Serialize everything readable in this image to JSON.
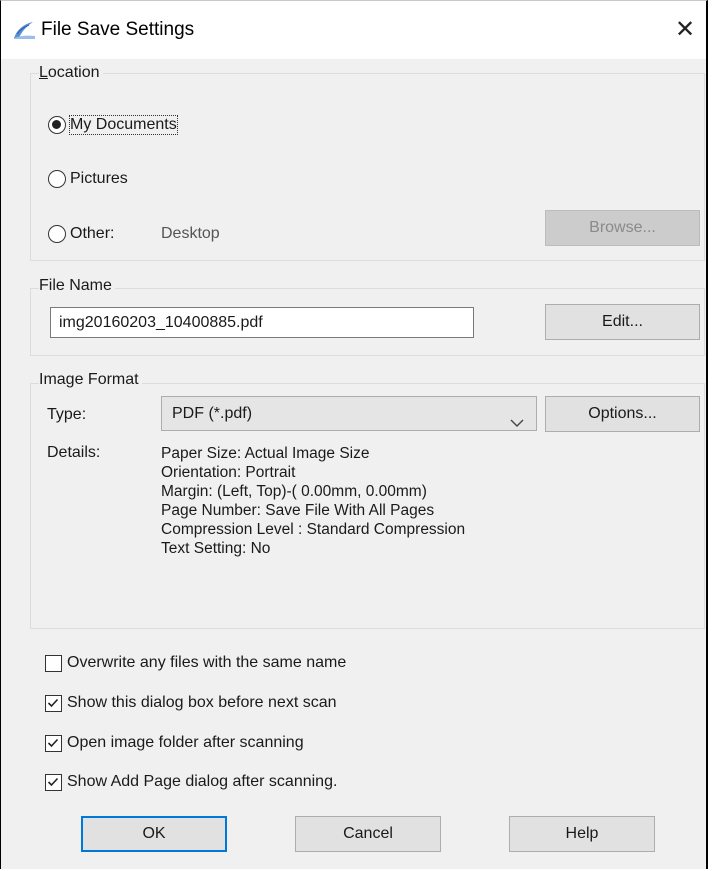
{
  "window": {
    "title": "File Save Settings",
    "close_glyph": "✕"
  },
  "location": {
    "label": "Location",
    "options": [
      {
        "label": "My Documents",
        "checked": true
      },
      {
        "label": "Pictures",
        "checked": false
      },
      {
        "label": "Other:",
        "checked": false
      }
    ],
    "other_value": "Desktop",
    "browse_label": "Browse..."
  },
  "file_name": {
    "label": "File Name",
    "value": "img20160203_10400885.pdf",
    "edit_label": "Edit..."
  },
  "image_format": {
    "label": "Image Format",
    "type_label": "Type:",
    "type_value": "PDF (*.pdf)",
    "options_label": "Options...",
    "details_label": "Details:",
    "details": [
      "Paper Size: Actual Image Size",
      "Orientation: Portrait",
      "Margin: (Left, Top)-( 0.00mm, 0.00mm)",
      "Page Number: Save File With All Pages",
      "Compression Level : Standard Compression",
      "Text Setting: No"
    ]
  },
  "checkboxes": [
    {
      "label": "Overwrite any files with the same name",
      "checked": false
    },
    {
      "label": "Show this dialog box before next scan",
      "checked": true
    },
    {
      "label": "Open image folder after scanning",
      "checked": true
    },
    {
      "label": "Show Add Page dialog after scanning.",
      "checked": true
    }
  ],
  "buttons": {
    "ok": "OK",
    "cancel": "Cancel",
    "help": "Help"
  },
  "icons": {
    "app": "scanner-feather-icon",
    "close": "close-icon",
    "dropdown": "chevron-down-icon",
    "check": "check-icon"
  },
  "colors": {
    "default_button_border": "#0078d7",
    "dialog_bg": "#f0f0f0"
  }
}
